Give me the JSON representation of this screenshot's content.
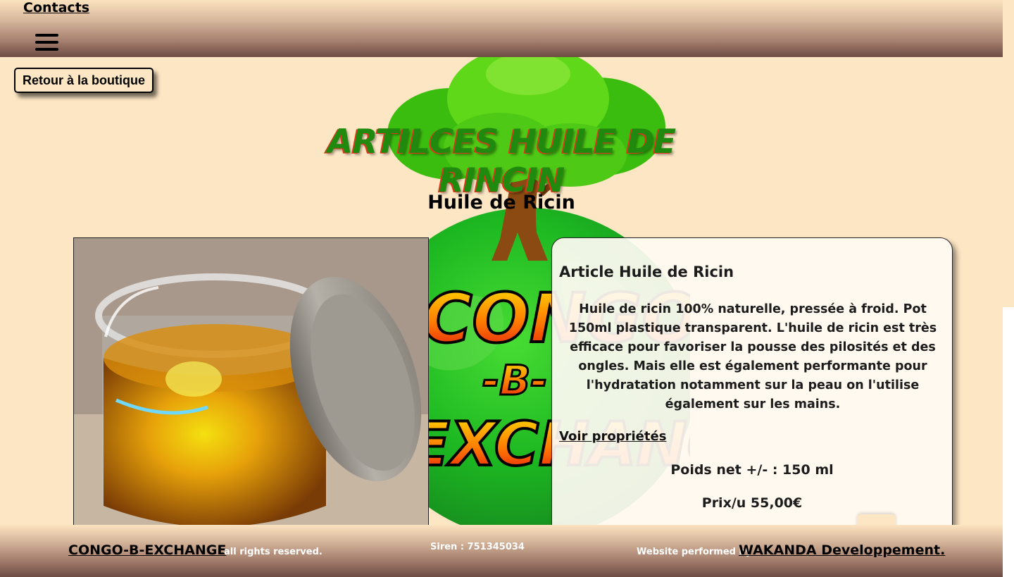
{
  "header": {
    "contacts_label": "Contacts",
    "menu_icon": "hamburger-menu-icon"
  },
  "back_button_label": "Retour à la boutique",
  "page_title": "ARTILCES HUILE DE RINCIN",
  "product_name": "Huile de Ricin",
  "background_logo": {
    "icon": "tree-globe-logo",
    "text_lines": [
      "CONGO",
      "-B-",
      "EXCHANGE"
    ]
  },
  "product_image": {
    "icon": "oil-jar-photo"
  },
  "card": {
    "title": "Article Huile de Ricin",
    "description": "Huile de ricin 100% naturelle, pressée à froid. Pot 150ml plastique transparent. L'huile de ricin est très efficace pour favoriser la pousse des pilosités et des ongles. Mais elle est également performante pour l'hydratation notamment sur la peau on l'utilise également sur les mains.",
    "properties_link": "Voir propriétés",
    "weight": "Poids net +/- : 150 ml",
    "price": "Prix/u 55,00€"
  },
  "footer": {
    "brand": "CONGO-B-EXCHANGE",
    "rights": "all rights reserved.",
    "siren": "Siren : 751345034",
    "performed_by": "Website performed by",
    "developer": "WAKANDA Developpement."
  },
  "colors": {
    "page_background": "#fde6c4",
    "title_green": "#1f8a0e",
    "title_red": "#e2341f",
    "footer_dark": "#6e4c44"
  }
}
